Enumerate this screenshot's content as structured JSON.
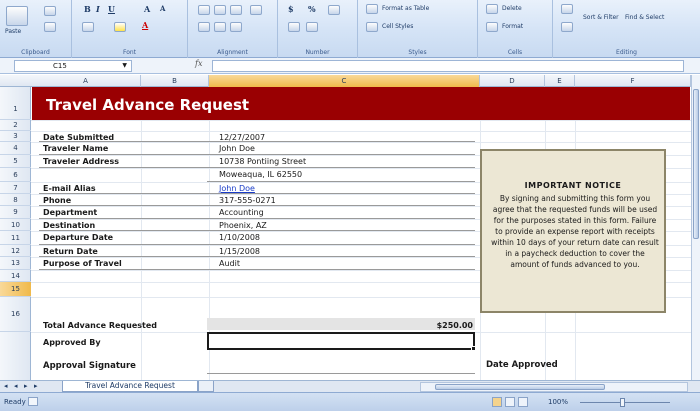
{
  "ribbon": {
    "paste_label": "Paste",
    "groups": {
      "clipboard": "Clipboard",
      "font": "Font",
      "alignment": "Alignment",
      "number": "Number",
      "styles": "Styles",
      "cells": "Cells",
      "editing": "Editing"
    },
    "format_as_table": "Format as Table",
    "cell_styles": "Cell Styles",
    "delete": "Delete",
    "format": "Format",
    "sort_filter": "Sort & Filter",
    "find_select": "Find & Select",
    "currency_symbol": "$",
    "percent_symbol": "%"
  },
  "formula_bar": {
    "name_box": "C15",
    "fx": "fx",
    "formula": ""
  },
  "columns": [
    "A",
    "B",
    "C",
    "D",
    "E",
    "F"
  ],
  "selected_column": "C",
  "rows": [
    "1",
    "2",
    "3",
    "4",
    "5",
    "6",
    "7",
    "8",
    "9",
    "10",
    "11",
    "12",
    "13",
    "14",
    "15",
    "16"
  ],
  "selected_row": "15",
  "form": {
    "title": "Travel Advance Request",
    "fields": [
      {
        "label": "Date Submitted",
        "value": "12/27/2007"
      },
      {
        "label": "Traveler Name",
        "value": "John Doe"
      },
      {
        "label": "Traveler Address",
        "value": "10738 Pontiing Street"
      },
      {
        "label": "",
        "value": "Moweaqua, IL 62550"
      },
      {
        "label": "E-mail Alias",
        "value": "John Doe"
      },
      {
        "label": "Phone",
        "value": "317-555-0271"
      },
      {
        "label": "Department",
        "value": "Accounting"
      },
      {
        "label": "Destination",
        "value": "Phoenix, AZ"
      },
      {
        "label": "Departure Date",
        "value": "1/10/2008"
      },
      {
        "label": "Return Date",
        "value": "1/15/2008"
      },
      {
        "label": "Purpose of Travel",
        "value": "Audit"
      }
    ],
    "total_label": "Total Advance Requested",
    "total_value": "$250.00",
    "approved_by_label": "Approved By",
    "approval_signature_label": "Approval Signature",
    "date_approved_label": "Date Approved"
  },
  "notice": {
    "title": "IMPORTANT NOTICE",
    "body": "By signing and submitting this form you agree that the requested funds will be used for the purposes stated in this form. Failure to provide an expense report with receipts within 10 days of your return date can result in a paycheck deduction to cover the amount of funds advanced to you."
  },
  "sheet_tabs": {
    "active": "Travel Advance Request"
  },
  "status_bar": {
    "ready": "Ready",
    "zoom": "100%"
  },
  "colors": {
    "title_banner": "#9a0002",
    "notice_bg": "#ece7d4",
    "link": "#1a3cc8"
  }
}
